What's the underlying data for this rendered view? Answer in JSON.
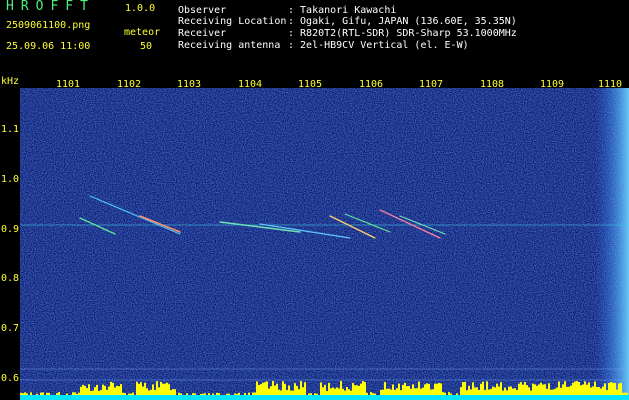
{
  "header": {
    "app_title": "HROFFT",
    "version": "1.0.0",
    "file_name": "2509061100.png",
    "meteor_label": "meteor",
    "date_time": "25.09.06 11:00",
    "meteor_count": "50"
  },
  "info": [
    {
      "key": "Observer",
      "value": ": Takanori Kawachi"
    },
    {
      "key": "Receiving Location",
      "value": ": Ogaki, Gifu, JAPAN (136.60E, 35.35N)"
    },
    {
      "key": "Receiver",
      "value": ": R820T2(RTL-SDR) SDR-Sharp 53.1000MHz"
    },
    {
      "key": "Receiving antenna",
      "value": ": 2el-HB9CV Vertical (el. E-W)"
    }
  ],
  "axis": {
    "unit": "kHz",
    "y_ticks": [
      "1.1",
      "1.0",
      "0.9",
      "0.8",
      "0.7",
      "0.6"
    ],
    "x_ticks": [
      "1101",
      "1102",
      "1103",
      "1104",
      "1105",
      "1106",
      "1107",
      "1108",
      "1109",
      "1110"
    ]
  },
  "colors": {
    "background": "#000000",
    "spectrogram_bg": "#0a1a6e",
    "header_green": "#4cf07a",
    "axis_yellow": "#ffff33",
    "histogram_fill": "#ffff00",
    "baseline_cyan": "#00e5ff"
  }
}
